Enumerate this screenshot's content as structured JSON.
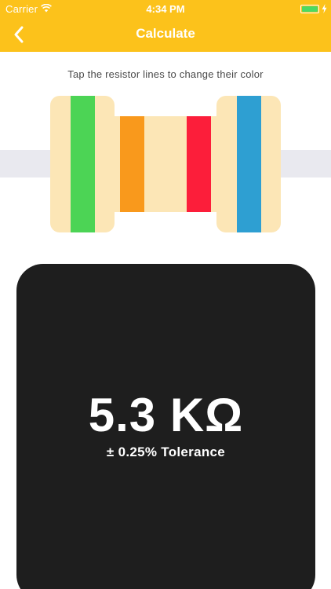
{
  "status_bar": {
    "carrier": "Carrier",
    "time": "4:34 PM",
    "battery_level": 1.0
  },
  "nav": {
    "title": "Calculate",
    "back_icon": "chevron-left-icon"
  },
  "instruction": "Tap the resistor lines to change their color",
  "resistor": {
    "body_color": "#FCE6B6",
    "wire_color": "#E9E9EF",
    "bands": [
      {
        "name": "green",
        "color": "#4CD455"
      },
      {
        "name": "orange",
        "color": "#F9991C"
      },
      {
        "name": "red",
        "color": "#FC1E3A"
      },
      {
        "name": "blue",
        "color": "#2E9FD2"
      }
    ]
  },
  "result": {
    "value": "5.3 KΩ",
    "tolerance": "± 0.25% Tolerance"
  },
  "colors": {
    "accent": "#FCC21B",
    "card_background": "#1E1E1E"
  }
}
